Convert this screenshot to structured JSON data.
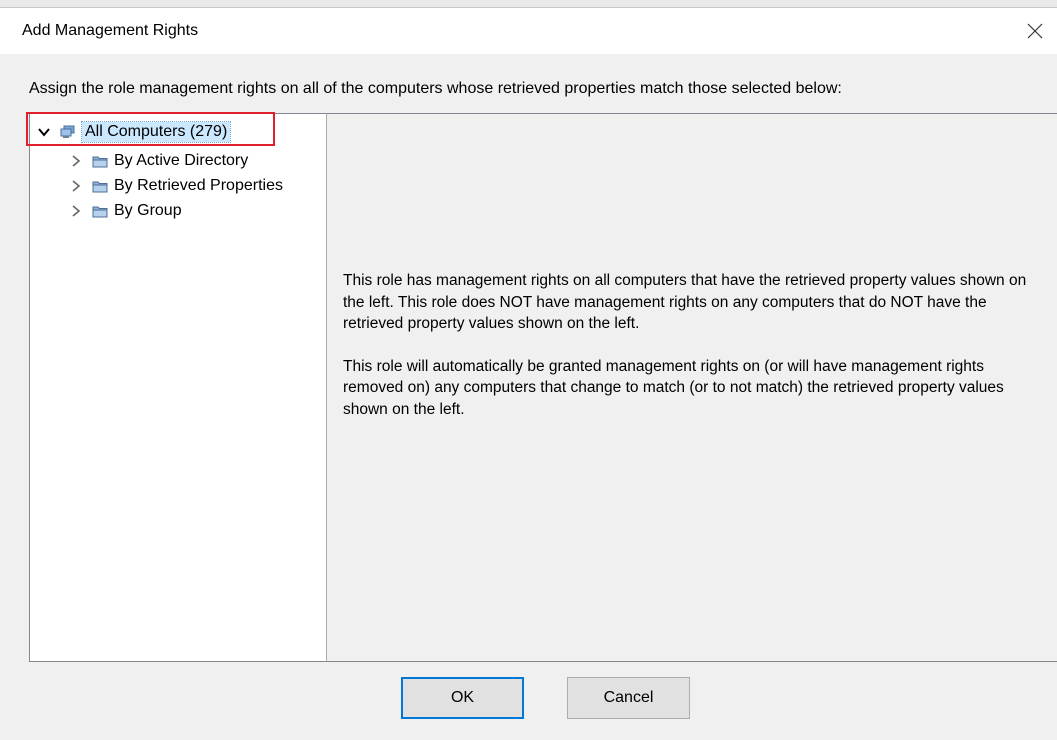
{
  "window": {
    "title": "Add Management Rights"
  },
  "instruction": "Assign the role management rights on all of the computers whose retrieved properties match those selected below:",
  "tree": {
    "root": {
      "label": "All Computers (279)",
      "icon": "computers-icon",
      "expanded": true,
      "selected": true
    },
    "children": [
      {
        "label": "By Active Directory",
        "icon": "folder-icon",
        "expanded": false
      },
      {
        "label": "By Retrieved Properties",
        "icon": "folder-icon",
        "expanded": false
      },
      {
        "label": "By Group",
        "icon": "folder-icon",
        "expanded": false
      }
    ]
  },
  "info": {
    "paragraph1": "This role has management rights on all computers that have the retrieved property values shown on the left. This role does NOT have management rights on any computers that do NOT have the retrieved property values shown on the left.",
    "paragraph2": "This role will automatically be granted management rights on (or will have management rights removed on) any computers that change to match (or to not match) the retrieved property values shown on the left."
  },
  "buttons": {
    "ok_label": "OK",
    "cancel_label": "Cancel"
  },
  "colors": {
    "selection": "#cce8ff",
    "highlight_box": "#e0202a",
    "default_button_border": "#0078d7"
  }
}
